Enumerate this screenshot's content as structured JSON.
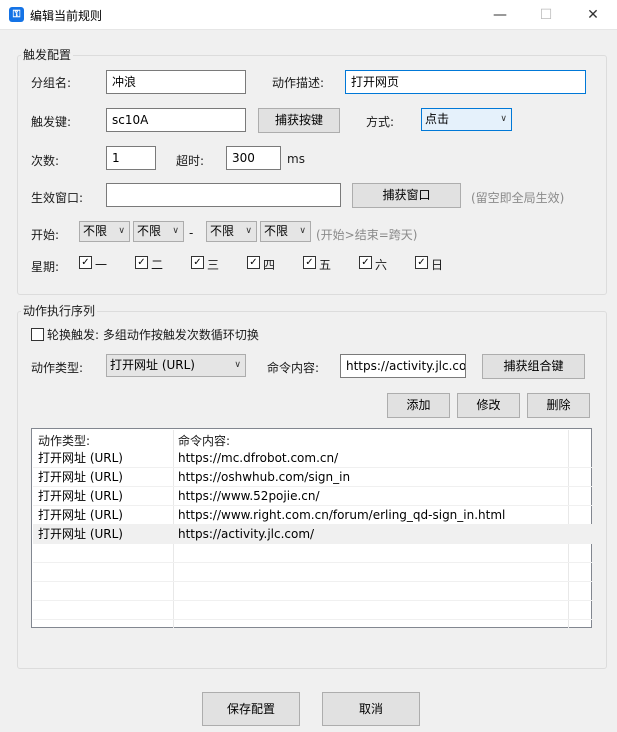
{
  "window": {
    "title": "编辑当前规则",
    "app_icon": "key-icon",
    "minimize": "—",
    "maximize": "☐",
    "close": "✕"
  },
  "trigger": {
    "section_title": "触发配置",
    "group_name_label": "分组名:",
    "group_name_value": "冲浪",
    "action_desc_label": "动作描述:",
    "action_desc_value": "打开网页",
    "trigger_key_label": "触发键:",
    "trigger_key_value": "sc10A",
    "capture_key_button": "捕获按键",
    "mode_label": "方式:",
    "mode_value": "点击",
    "count_label": "次数:",
    "count_value": "1",
    "timeout_label": "超时:",
    "timeout_value": "300",
    "timeout_unit": "ms",
    "window_label": "生效窗口:",
    "window_value": "",
    "capture_window_button": "捕获窗口",
    "window_hint": "(留空即全局生效)",
    "start_label": "开始:",
    "start_hour": "不限",
    "start_minute": "不限",
    "dash": "-",
    "end_hour": "不限",
    "end_minute": "不限",
    "time_hint": "(开始>结束=跨天)",
    "weekday_label": "星期:",
    "weekdays": [
      "一",
      "二",
      "三",
      "四",
      "五",
      "六",
      "日"
    ]
  },
  "sequence": {
    "section_title": "动作执行序列",
    "rotate_label": "轮换触发: 多组动作按触发次数循环切换",
    "rotate_checked": false,
    "action_type_label": "动作类型:",
    "action_type_value": "打开网址 (URL)",
    "command_label": "命令内容:",
    "command_value": "https://activity.jlc.com/",
    "capture_combo_button": "捕获组合键",
    "add_button": "添加",
    "edit_button": "修改",
    "delete_button": "删除",
    "columns": [
      "动作类型:",
      "命令内容:"
    ],
    "rows": [
      {
        "type": "打开网址 (URL)",
        "content": "https://mc.dfrobot.com.cn/"
      },
      {
        "type": "打开网址 (URL)",
        "content": "https://oshwhub.com/sign_in"
      },
      {
        "type": "打开网址 (URL)",
        "content": "https://www.52pojie.cn/"
      },
      {
        "type": "打开网址 (URL)",
        "content": "https://www.right.com.cn/forum/erling_qd-sign_in.html"
      },
      {
        "type": "打开网址 (URL)",
        "content": "https://activity.jlc.com/"
      }
    ]
  },
  "footer": {
    "save_button": "保存配置",
    "cancel_button": "取消"
  }
}
